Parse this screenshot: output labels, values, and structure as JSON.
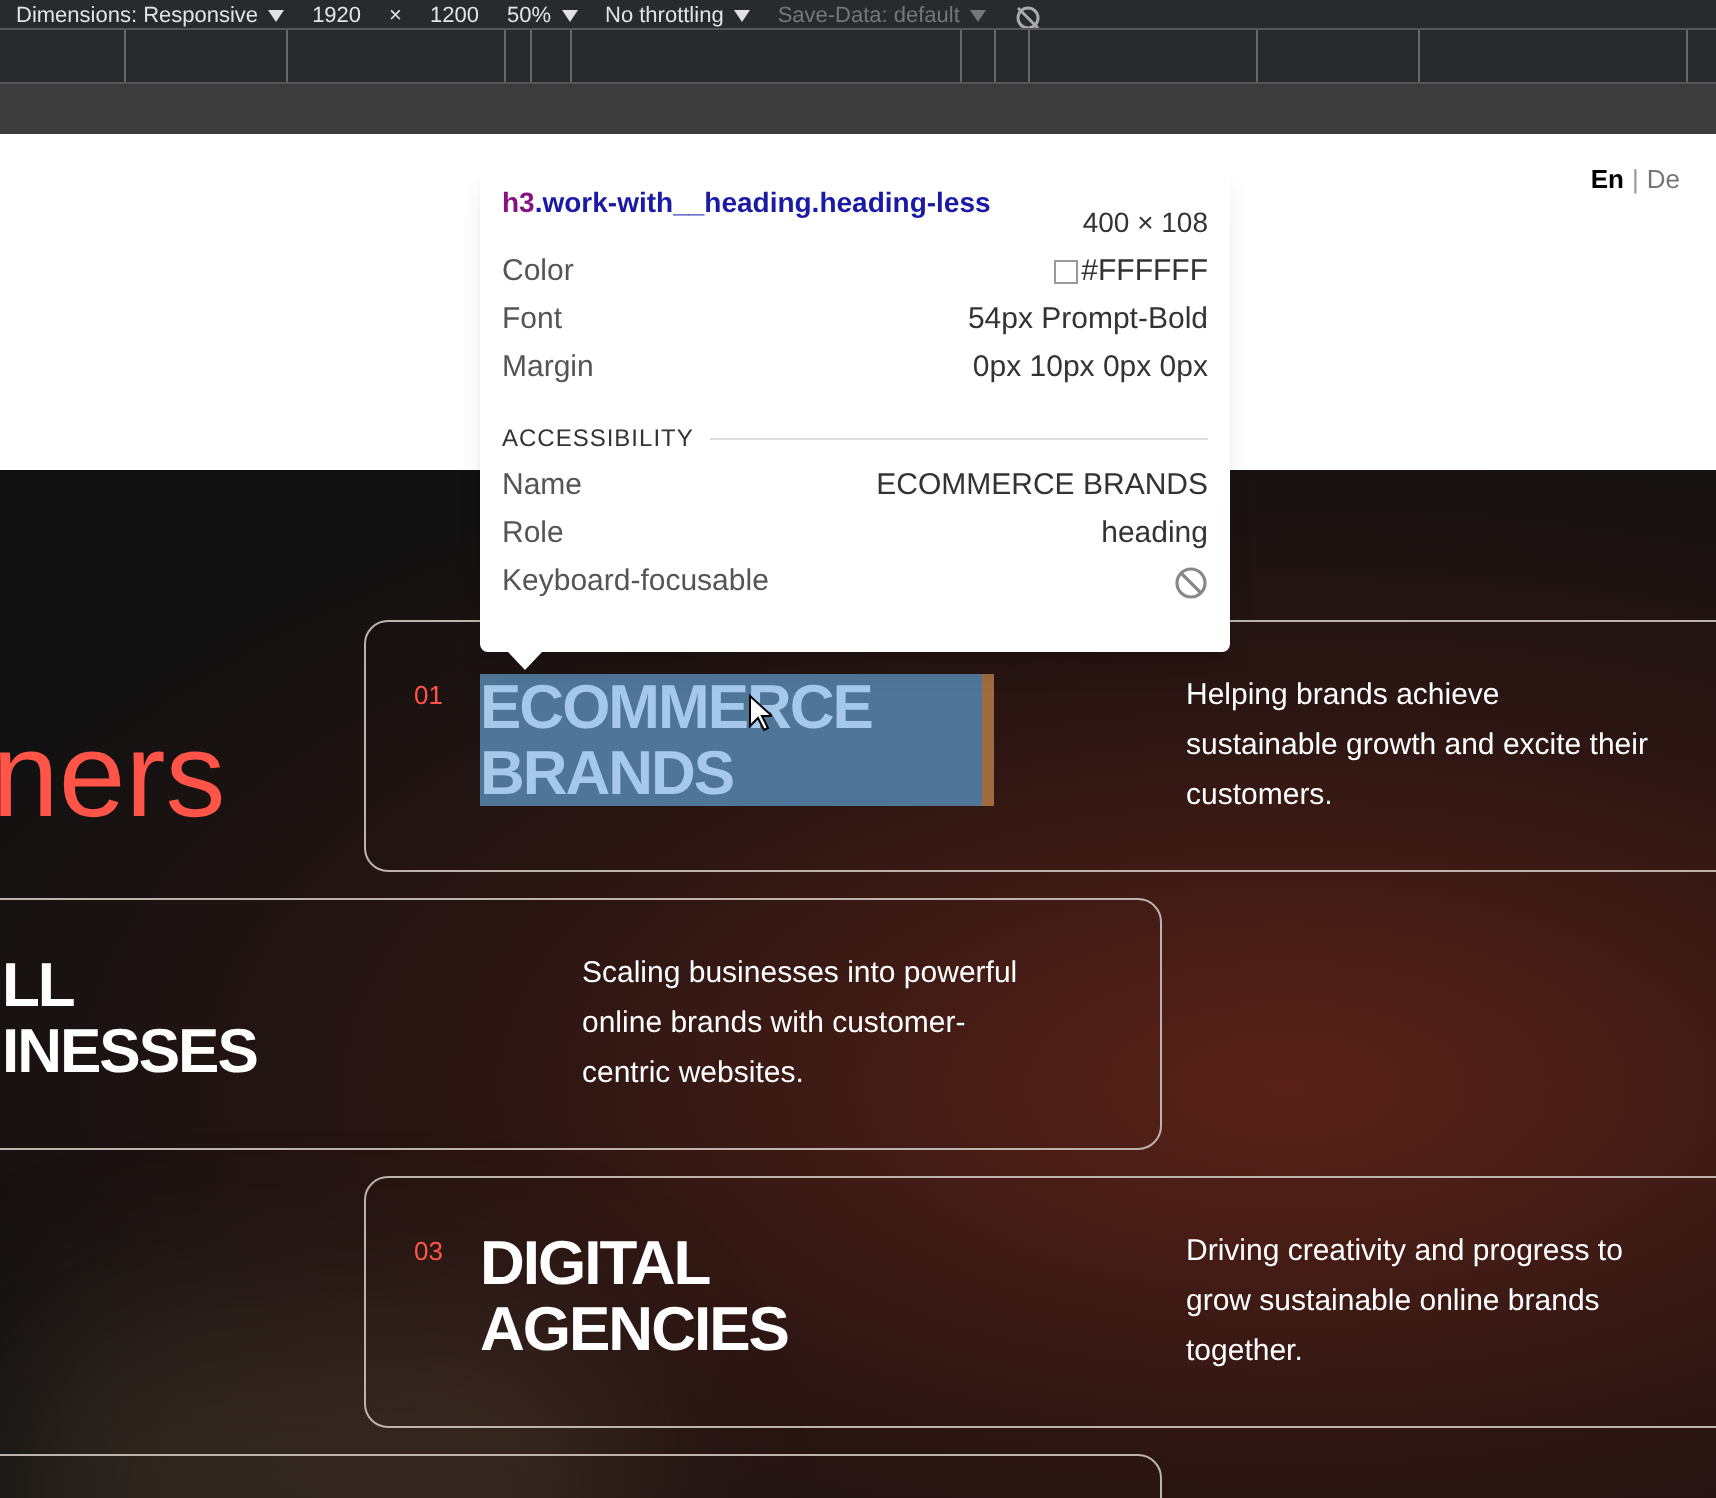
{
  "devtools": {
    "toolbar": [
      {
        "label": "Dimensions: Responsive",
        "dropdown": true
      },
      {
        "label": "1920",
        "dropdown": false
      },
      {
        "label": "×",
        "dropdown": false
      },
      {
        "label": "1200",
        "dropdown": false
      },
      {
        "label": "50%",
        "dropdown": true
      },
      {
        "label": "No throttling",
        "dropdown": true
      },
      {
        "label": "Save-Data: default",
        "dropdown": true,
        "disabled": true
      }
    ]
  },
  "header": {
    "languages": [
      {
        "label": "En",
        "selected": true
      },
      {
        "label": "De",
        "selected": false
      }
    ],
    "separator": "|"
  },
  "section": {
    "title_fragment": "ners",
    "cards": [
      {
        "number": "01",
        "heading": [
          "ECOMMERCE",
          "BRANDS"
        ],
        "description": "Helping brands achieve sustainable growth and excite their customers.",
        "highlighted": true
      },
      {
        "heading": [
          "LL",
          "INESSES"
        ],
        "description": "Scaling businesses into powerful online brands with customer-centric websites.",
        "highlighted": false
      },
      {
        "number": "03",
        "heading": [
          "DIGITAL",
          "AGENCIES"
        ],
        "description": "Driving creativity and progress to grow sustainable online brands together.",
        "highlighted": false
      },
      {
        "highlighted": false
      }
    ]
  },
  "tooltip": {
    "tag": "h3",
    "classes": ".work-with__heading.heading-less",
    "size": "400 × 108",
    "rows": [
      {
        "label": "Color",
        "value": "#FFFFFF",
        "kind": "color"
      },
      {
        "label": "Font",
        "value": "54px Prompt-Bold"
      },
      {
        "label": "Margin",
        "value": "0px 10px 0px 0px"
      }
    ],
    "accessibility": {
      "title": "ACCESSIBILITY",
      "rows": [
        {
          "label": "Name",
          "value": "ECOMMERCE BRANDS"
        },
        {
          "label": "Role",
          "value": "heading"
        },
        {
          "label": "Keyboard-focusable",
          "kind": "icon"
        }
      ]
    }
  }
}
